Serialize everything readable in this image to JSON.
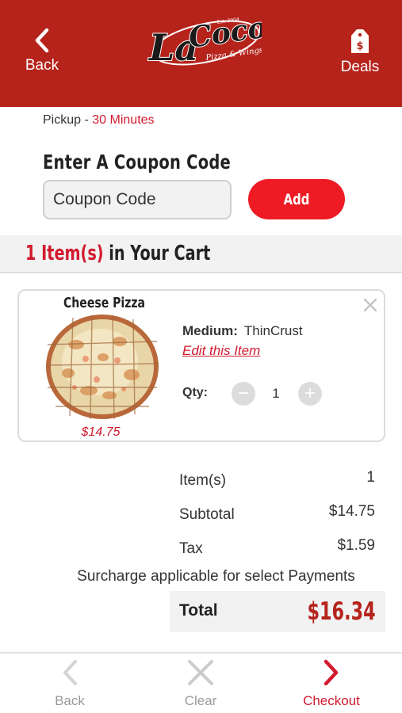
{
  "header": {
    "back_label": "Back",
    "deals_label": "Deals",
    "logo": {
      "name": "LaCoco's",
      "tagline": "Pizza & Wings",
      "est": "Est. 2004"
    },
    "color": "#b5231b"
  },
  "pickup": {
    "label": "Pickup",
    "separator": "-",
    "time": "30 Minutes"
  },
  "coupon": {
    "title": "Enter A Coupon Code",
    "placeholder": "Coupon Code",
    "add_label": "Add"
  },
  "cart": {
    "count": "1 Item(s)",
    "heading_suffix": "in Your Cart"
  },
  "item": {
    "name": "Cheese Pizza",
    "price": "$14.75",
    "size_label": "Medium:",
    "size_value": "ThinCrust",
    "edit_label": "Edit this Item",
    "qty_label": "Qty:",
    "qty_minus": "−",
    "qty_plus": "+",
    "qty": "1"
  },
  "summary": {
    "rows": [
      {
        "label": "Item(s)",
        "value": "1"
      },
      {
        "label": "Subtotal",
        "value": "$14.75"
      },
      {
        "label": "Tax",
        "value": "$1.59"
      }
    ],
    "surcharge_note": "Surcharge applicable for select Payments",
    "total_label": "Total",
    "total_value": "$16.34"
  },
  "footer": {
    "back_label": "Back",
    "clear_label": "Clear",
    "checkout_label": "Checkout"
  },
  "colors": {
    "brand_red": "#b5231b",
    "accent_red": "#d11a2e",
    "button_red": "#ee1b24",
    "muted_gray": "#999999"
  },
  "icons": [
    "chevron-left-icon",
    "price-tag-icon",
    "close-icon",
    "minus-icon",
    "plus-icon",
    "chevron-right-icon"
  ]
}
